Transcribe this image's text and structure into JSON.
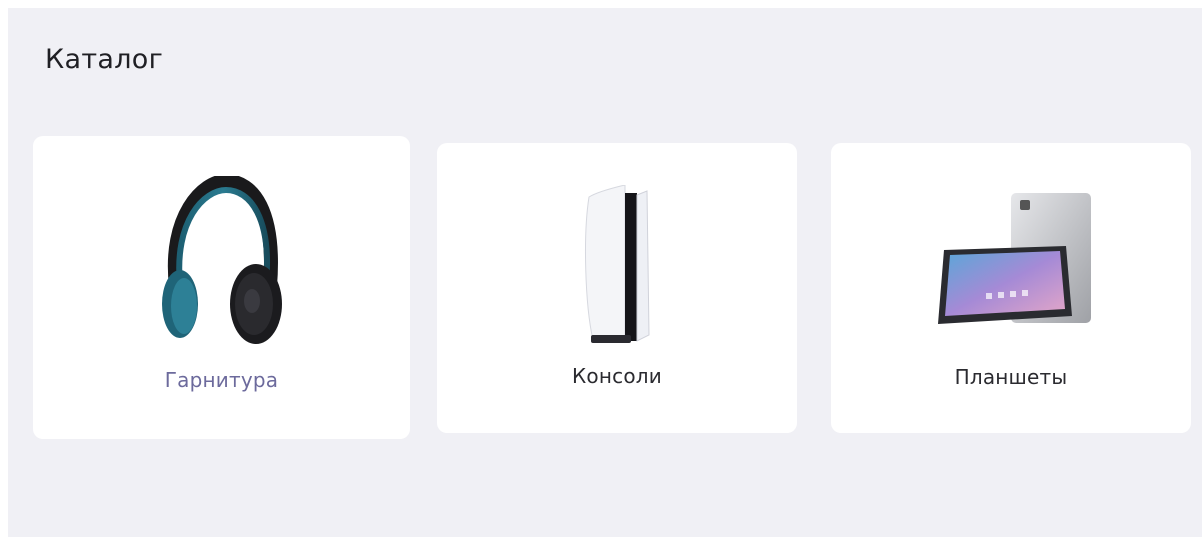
{
  "catalog": {
    "title": "Каталог",
    "categories": [
      {
        "label": "Гарнитура",
        "icon": "headphones-icon",
        "active": true
      },
      {
        "label": "Консоли",
        "icon": "game-console-icon",
        "active": false
      },
      {
        "label": "Планшеты",
        "icon": "tablet-icon",
        "active": false
      }
    ]
  },
  "colors": {
    "panel_background": "#f0f0f5",
    "card_background": "#ffffff",
    "active_label": "#6c6a9c",
    "label": "#2b2b30"
  }
}
